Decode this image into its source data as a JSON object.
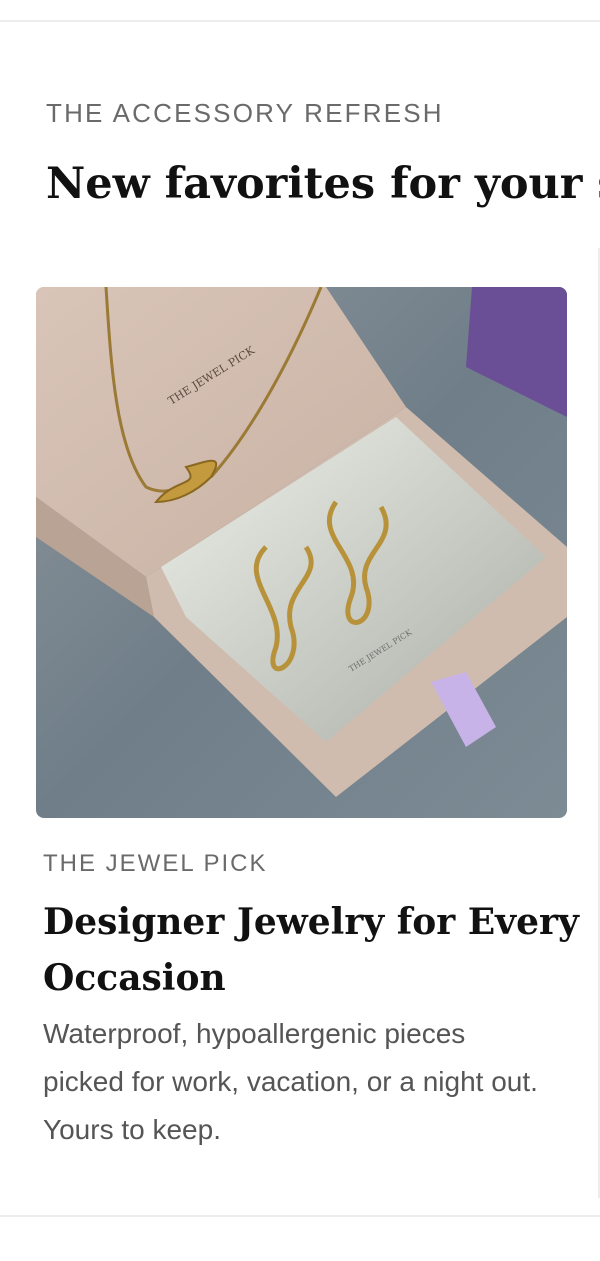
{
  "section": {
    "kicker": "THE ACCESSORY REFRESH",
    "title": "New favorites for your spring lineup"
  },
  "card": {
    "brand": "THE JEWEL PICK",
    "title": "Designer Jewelry for Every Occasion",
    "description": "Waterproof, hypoallergenic pieces picked for work, vacation, or a night out. Yours to keep.",
    "image": {
      "box_print": "THE JEWEL PICK",
      "insert_print": "THE JEWEL PICK"
    }
  },
  "colors": {
    "kicker": "#6a6a6a",
    "title": "#111111",
    "description": "#555555",
    "divider": "#ececec",
    "box": "#d6c2b6",
    "fabric": "#7f8a92",
    "ribbon": "#c8b3e8",
    "gold": "#b8923a"
  }
}
